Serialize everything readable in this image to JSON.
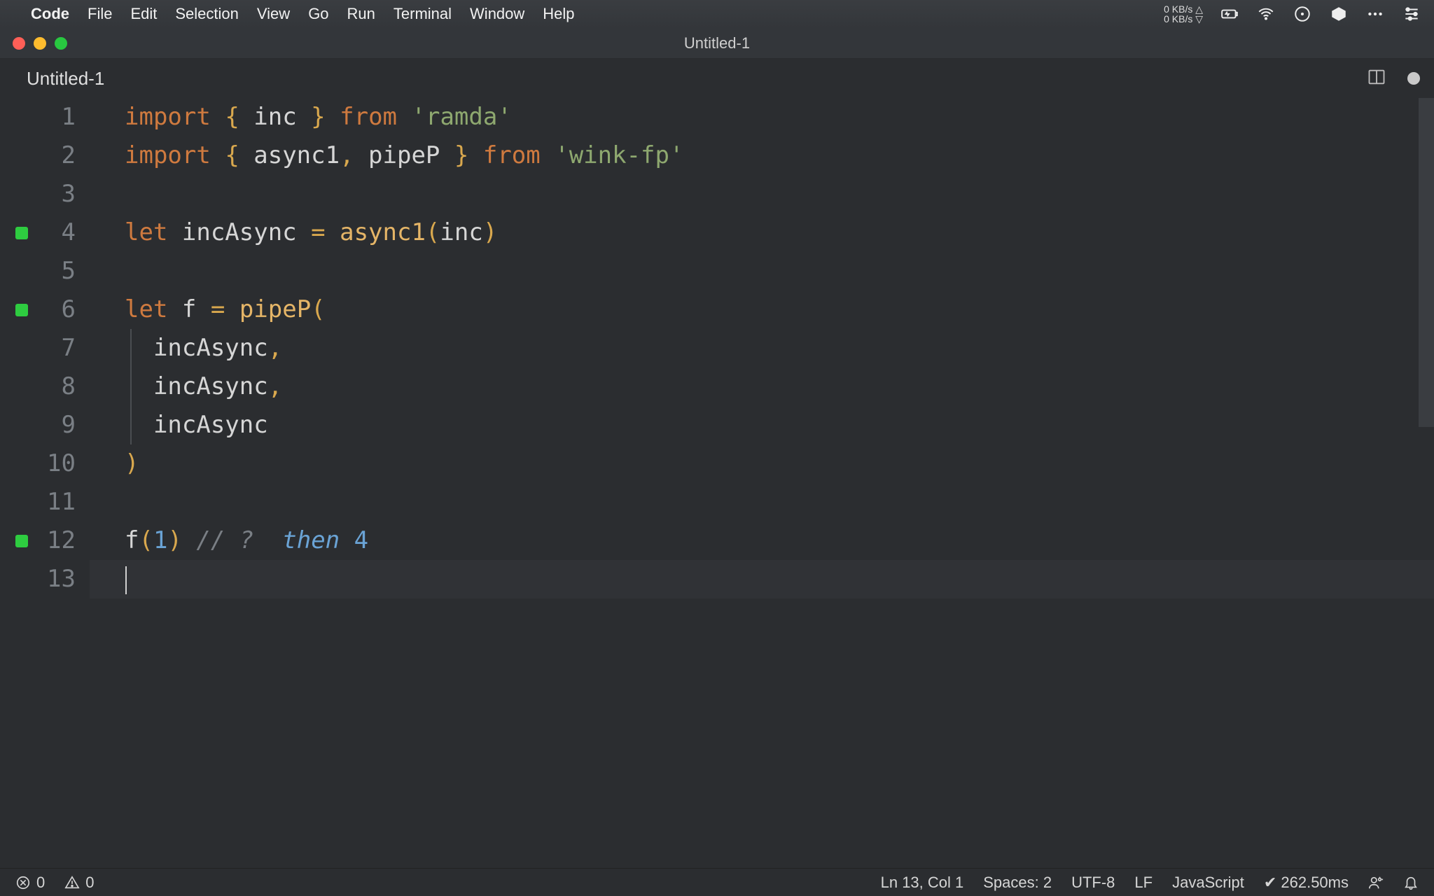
{
  "mac_menu": {
    "app_name": "Code",
    "items": [
      "File",
      "Edit",
      "Selection",
      "View",
      "Go",
      "Run",
      "Terminal",
      "Window",
      "Help"
    ],
    "net_up": "0 KB/s",
    "net_down": "0 KB/s"
  },
  "window_title": "Untitled-1",
  "tab": {
    "label": "Untitled-1",
    "modified": true
  },
  "code": {
    "lines": [
      {
        "n": 1,
        "mark": false,
        "tokens": [
          [
            "kw",
            "import"
          ],
          [
            "id",
            " "
          ],
          [
            "pn",
            "{"
          ],
          [
            "id",
            " inc "
          ],
          [
            "pn",
            "}"
          ],
          [
            "id",
            " "
          ],
          [
            "kw",
            "from"
          ],
          [
            "id",
            " "
          ],
          [
            "str",
            "'ramda'"
          ]
        ]
      },
      {
        "n": 2,
        "mark": false,
        "tokens": [
          [
            "kw",
            "import"
          ],
          [
            "id",
            " "
          ],
          [
            "pn",
            "{"
          ],
          [
            "id",
            " async1"
          ],
          [
            "pn",
            ","
          ],
          [
            "id",
            " pipeP "
          ],
          [
            "pn",
            "}"
          ],
          [
            "id",
            " "
          ],
          [
            "kw",
            "from"
          ],
          [
            "id",
            " "
          ],
          [
            "str",
            "'wink-fp'"
          ]
        ]
      },
      {
        "n": 3,
        "mark": false,
        "tokens": []
      },
      {
        "n": 4,
        "mark": true,
        "tokens": [
          [
            "kw",
            "let"
          ],
          [
            "id",
            " incAsync "
          ],
          [
            "pn",
            "="
          ],
          [
            "id",
            " "
          ],
          [
            "fn",
            "async1"
          ],
          [
            "pn",
            "("
          ],
          [
            "id",
            "inc"
          ],
          [
            "pn",
            ")"
          ]
        ]
      },
      {
        "n": 5,
        "mark": false,
        "tokens": []
      },
      {
        "n": 6,
        "mark": true,
        "tokens": [
          [
            "kw",
            "let"
          ],
          [
            "id",
            " f "
          ],
          [
            "pn",
            "="
          ],
          [
            "id",
            " "
          ],
          [
            "fn",
            "pipeP"
          ],
          [
            "pn",
            "("
          ]
        ]
      },
      {
        "n": 7,
        "mark": false,
        "indent": true,
        "tokens": [
          [
            "id",
            "  incAsync"
          ],
          [
            "pn",
            ","
          ]
        ]
      },
      {
        "n": 8,
        "mark": false,
        "indent": true,
        "tokens": [
          [
            "id",
            "  incAsync"
          ],
          [
            "pn",
            ","
          ]
        ]
      },
      {
        "n": 9,
        "mark": false,
        "indent": true,
        "tokens": [
          [
            "id",
            "  incAsync"
          ]
        ]
      },
      {
        "n": 10,
        "mark": false,
        "tokens": [
          [
            "pn",
            ")"
          ]
        ]
      },
      {
        "n": 11,
        "mark": false,
        "tokens": []
      },
      {
        "n": 12,
        "mark": true,
        "tokens": [
          [
            "id",
            "f"
          ],
          [
            "pn",
            "("
          ],
          [
            "num",
            "1"
          ],
          [
            "pn",
            ")"
          ],
          [
            "id",
            " "
          ],
          [
            "cm",
            "// ?  "
          ],
          [
            "cmkw",
            "then"
          ],
          [
            "cm",
            " "
          ],
          [
            "num",
            "4"
          ]
        ]
      },
      {
        "n": 13,
        "mark": false,
        "current": true,
        "tokens": []
      }
    ]
  },
  "status": {
    "errors": "0",
    "warnings": "0",
    "cursor": "Ln 13, Col 1",
    "indent": "Spaces: 2",
    "encoding": "UTF-8",
    "eol": "LF",
    "language": "JavaScript",
    "quokka": "✔ 262.50ms"
  }
}
